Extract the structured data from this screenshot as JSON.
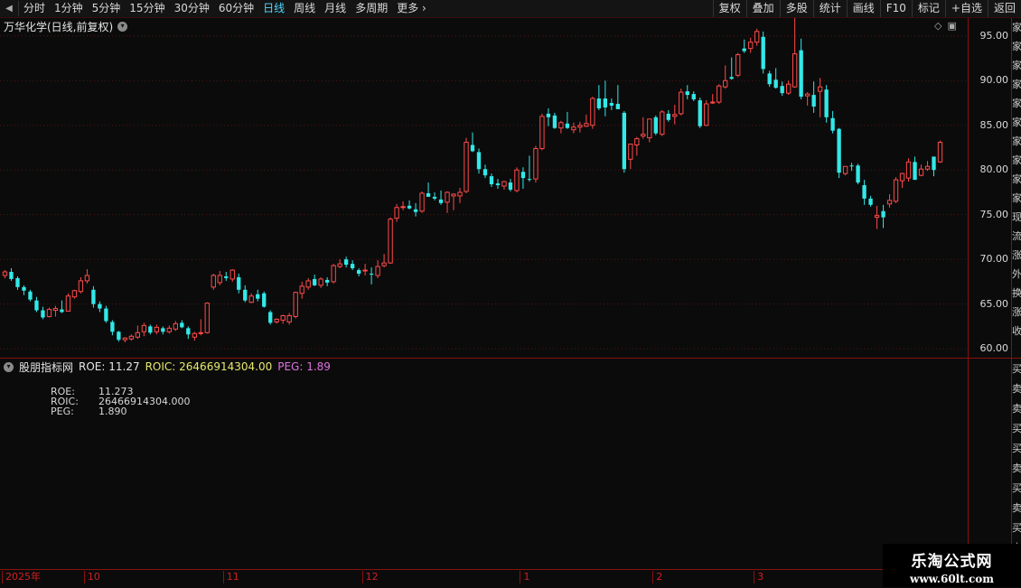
{
  "toolbar": {
    "periods": [
      {
        "label": "分时",
        "active": false
      },
      {
        "label": "1分钟",
        "active": false
      },
      {
        "label": "5分钟",
        "active": false
      },
      {
        "label": "15分钟",
        "active": false
      },
      {
        "label": "30分钟",
        "active": false
      },
      {
        "label": "60分钟",
        "active": false
      },
      {
        "label": "日线",
        "active": true
      },
      {
        "label": "周线",
        "active": false
      },
      {
        "label": "月线",
        "active": false
      },
      {
        "label": "多周期",
        "active": false
      },
      {
        "label": "更多",
        "active": false
      }
    ],
    "right_buttons": [
      "复权",
      "叠加",
      "多股",
      "统计",
      "画线",
      "F10",
      "标记",
      "+自选",
      "返回"
    ]
  },
  "chart": {
    "title": "万华化学(日线,前复权)",
    "price_ticks": [
      "95.00",
      "90.00",
      "85.00",
      "80.00",
      "75.00",
      "70.00",
      "65.00",
      "60.00"
    ],
    "right_strip_text": "家家家家家家家家家家现流涨外换涨收",
    "lower_strip_text": "买卖卖买买卖买卖买卖"
  },
  "indicator": {
    "name": "股朋指标网",
    "roe_text": "ROE: 11.27",
    "roic_text": "ROIC: 26466914304.00",
    "peg_text": "PEG: 1.89",
    "rows": [
      {
        "label": "ROE:",
        "value": "11.273"
      },
      {
        "label": "ROIC:",
        "value": "26466914304.000"
      },
      {
        "label": "PEG:",
        "value": "1.890"
      }
    ],
    "colors": {
      "roe": "#e6e6e6",
      "roic": "#e8e870",
      "peg": "#e070e0"
    }
  },
  "date_axis": {
    "labels": [
      {
        "text": "2025年",
        "index": 0
      },
      {
        "text": "10",
        "index": 13
      },
      {
        "text": "11",
        "index": 35
      },
      {
        "text": "12",
        "index": 57
      },
      {
        "text": "1",
        "index": 82
      },
      {
        "text": "2",
        "index": 103
      },
      {
        "text": "3",
        "index": 119
      }
    ]
  },
  "watermark": {
    "title": "乐淘公式网",
    "url": "www.60lt.com"
  },
  "colors": {
    "up": "#ff4a4a",
    "down": "#33e8e8",
    "grid": "#5a1414",
    "axis": "#8a1010",
    "active_tab": "#4fd8ff"
  },
  "chart_data": {
    "type": "candlestick",
    "title": "万华化学(日线,前复权)",
    "ylim": [
      59,
      97
    ],
    "candles": [
      [
        68.2,
        68.8,
        67.9,
        68.6
      ],
      [
        68.6,
        69.0,
        67.6,
        67.8
      ],
      [
        67.9,
        68.1,
        66.6,
        66.9
      ],
      [
        66.9,
        67.1,
        66.0,
        66.5
      ],
      [
        66.4,
        66.6,
        65.3,
        65.5
      ],
      [
        65.4,
        65.8,
        64.1,
        64.3
      ],
      [
        64.3,
        64.7,
        63.3,
        63.5
      ],
      [
        63.6,
        64.6,
        63.5,
        64.4
      ],
      [
        64.3,
        64.8,
        63.6,
        64.5
      ],
      [
        64.4,
        65.4,
        64.0,
        64.1
      ],
      [
        64.2,
        66.2,
        64.2,
        65.9
      ],
      [
        65.8,
        66.6,
        65.6,
        66.5
      ],
      [
        66.4,
        68.0,
        66.2,
        67.6
      ],
      [
        67.6,
        68.9,
        67.3,
        68.2
      ],
      [
        66.6,
        67.0,
        64.6,
        65.0
      ],
      [
        65.0,
        65.3,
        64.1,
        64.5
      ],
      [
        64.5,
        64.8,
        62.9,
        63.1
      ],
      [
        63.0,
        63.2,
        61.5,
        61.9
      ],
      [
        61.9,
        62.0,
        60.8,
        61.0
      ],
      [
        61.0,
        61.3,
        60.7,
        61.2
      ],
      [
        61.1,
        61.6,
        60.9,
        61.4
      ],
      [
        61.3,
        62.6,
        61.1,
        61.8
      ],
      [
        61.9,
        62.9,
        61.4,
        62.6
      ],
      [
        62.5,
        62.7,
        61.6,
        61.8
      ],
      [
        61.9,
        62.7,
        61.6,
        62.4
      ],
      [
        62.3,
        62.5,
        61.6,
        61.9
      ],
      [
        61.9,
        62.6,
        61.7,
        62.3
      ],
      [
        62.2,
        63.1,
        62.0,
        62.8
      ],
      [
        62.9,
        63.2,
        62.3,
        62.4
      ],
      [
        62.3,
        62.5,
        61.1,
        61.6
      ],
      [
        61.3,
        61.9,
        60.9,
        61.7
      ],
      [
        61.8,
        63.3,
        61.5,
        61.8
      ],
      [
        61.8,
        65.2,
        61.7,
        65.1
      ],
      [
        66.9,
        68.4,
        66.6,
        68.2
      ],
      [
        67.4,
        68.7,
        67.1,
        68.2
      ],
      [
        68.1,
        68.6,
        67.6,
        67.9
      ],
      [
        67.8,
        68.9,
        67.5,
        68.8
      ],
      [
        68.0,
        68.4,
        66.2,
        66.6
      ],
      [
        66.6,
        67.1,
        65.2,
        65.4
      ],
      [
        65.2,
        66.2,
        65.1,
        65.9
      ],
      [
        66.1,
        66.6,
        65.3,
        65.6
      ],
      [
        66.2,
        66.4,
        64.6,
        64.7
      ],
      [
        64.1,
        64.3,
        62.7,
        62.9
      ],
      [
        63.0,
        63.4,
        62.8,
        63.3
      ],
      [
        63.2,
        63.8,
        62.8,
        63.7
      ],
      [
        63.0,
        64.0,
        62.7,
        63.7
      ],
      [
        63.6,
        66.4,
        63.4,
        66.3
      ],
      [
        66.2,
        67.5,
        65.6,
        67.0
      ],
      [
        66.9,
        67.9,
        66.6,
        67.6
      ],
      [
        67.8,
        68.3,
        67.0,
        67.1
      ],
      [
        67.1,
        68.0,
        66.8,
        67.8
      ],
      [
        67.7,
        68.0,
        67.0,
        67.4
      ],
      [
        67.5,
        69.5,
        67.3,
        69.3
      ],
      [
        69.2,
        70.0,
        69.0,
        69.5
      ],
      [
        70.0,
        70.3,
        69.1,
        69.4
      ],
      [
        69.5,
        69.9,
        68.8,
        69.0
      ],
      [
        68.8,
        69.0,
        68.1,
        68.4
      ],
      [
        68.8,
        69.5,
        68.2,
        68.8
      ],
      [
        68.4,
        69.1,
        67.2,
        68.3
      ],
      [
        68.2,
        69.9,
        67.9,
        69.2
      ],
      [
        69.3,
        70.6,
        69.1,
        69.6
      ],
      [
        69.6,
        74.7,
        69.5,
        74.5
      ],
      [
        74.6,
        76.2,
        74.2,
        75.8
      ],
      [
        75.8,
        76.5,
        75.5,
        75.9
      ],
      [
        76.0,
        76.6,
        75.6,
        75.7
      ],
      [
        75.6,
        76.3,
        74.8,
        75.3
      ],
      [
        75.4,
        77.6,
        75.2,
        77.4
      ],
      [
        77.4,
        78.6,
        77.0,
        77.0
      ],
      [
        77.0,
        77.5,
        76.6,
        76.8
      ],
      [
        76.7,
        77.7,
        76.1,
        76.3
      ],
      [
        76.4,
        77.6,
        75.2,
        77.5
      ],
      [
        77.1,
        77.4,
        75.5,
        77.3
      ],
      [
        77.1,
        78.0,
        76.3,
        77.5
      ],
      [
        77.6,
        83.6,
        77.4,
        83.1
      ],
      [
        82.8,
        84.2,
        82.0,
        82.1
      ],
      [
        82.0,
        82.4,
        79.6,
        80.1
      ],
      [
        80.1,
        80.6,
        79.1,
        79.4
      ],
      [
        79.3,
        79.6,
        78.1,
        78.4
      ],
      [
        78.5,
        79.0,
        77.9,
        78.3
      ],
      [
        78.2,
        78.8,
        77.8,
        78.7
      ],
      [
        78.6,
        79.0,
        77.6,
        77.8
      ],
      [
        77.7,
        80.3,
        77.5,
        80.0
      ],
      [
        79.8,
        80.3,
        77.9,
        79.1
      ],
      [
        79.0,
        81.6,
        78.7,
        78.9
      ],
      [
        79.0,
        82.7,
        78.6,
        82.4
      ],
      [
        82.4,
        86.3,
        82.2,
        86.0
      ],
      [
        86.3,
        86.9,
        84.9,
        85.9
      ],
      [
        86.1,
        86.4,
        84.6,
        84.7
      ],
      [
        84.7,
        85.5,
        84.1,
        85.3
      ],
      [
        85.2,
        86.5,
        84.6,
        84.7
      ],
      [
        84.5,
        85.3,
        84.1,
        84.8
      ],
      [
        84.8,
        85.4,
        84.2,
        85.0
      ],
      [
        84.9,
        86.2,
        84.8,
        85.2
      ],
      [
        85.0,
        88.2,
        84.6,
        88.0
      ],
      [
        88.0,
        89.5,
        86.7,
        86.9
      ],
      [
        88.0,
        90.0,
        86.0,
        87.0
      ],
      [
        87.5,
        88.0,
        86.7,
        87.2
      ],
      [
        87.4,
        89.5,
        86.9,
        86.8
      ],
      [
        86.4,
        86.6,
        79.7,
        80.1
      ],
      [
        81.2,
        82.0,
        80.1,
        82.9
      ],
      [
        82.8,
        83.7,
        81.6,
        83.5
      ],
      [
        83.8,
        85.9,
        83.5,
        84.0
      ],
      [
        83.6,
        84.6,
        83.1,
        85.7
      ],
      [
        85.9,
        86.1,
        83.9,
        84.1
      ],
      [
        84.0,
        86.7,
        83.8,
        86.5
      ],
      [
        86.3,
        86.7,
        85.4,
        85.6
      ],
      [
        86.0,
        87.3,
        85.1,
        86.2
      ],
      [
        86.3,
        89.1,
        86.1,
        88.7
      ],
      [
        88.8,
        89.5,
        87.9,
        88.4
      ],
      [
        88.5,
        88.8,
        87.7,
        87.9
      ],
      [
        87.8,
        88.1,
        84.7,
        84.9
      ],
      [
        85.0,
        87.8,
        84.9,
        87.4
      ],
      [
        87.6,
        88.5,
        87.4,
        87.6
      ],
      [
        87.6,
        89.6,
        87.4,
        89.4
      ],
      [
        89.3,
        91.7,
        89.1,
        90.0
      ],
      [
        90.4,
        92.6,
        90.1,
        90.2
      ],
      [
        90.6,
        93.1,
        90.4,
        92.9
      ],
      [
        93.6,
        94.6,
        93.1,
        93.3
      ],
      [
        93.6,
        94.8,
        93.1,
        94.3
      ],
      [
        94.3,
        95.8,
        93.9,
        95.5
      ],
      [
        94.9,
        95.5,
        90.8,
        91.3
      ],
      [
        90.8,
        91.1,
        89.3,
        89.6
      ],
      [
        90.1,
        91.4,
        89.1,
        89.2
      ],
      [
        89.4,
        89.9,
        88.3,
        88.6
      ],
      [
        88.6,
        90.0,
        88.4,
        89.6
      ],
      [
        89.3,
        97.1,
        89.2,
        93.0
      ],
      [
        93.4,
        94.7,
        87.9,
        88.2
      ],
      [
        88.3,
        88.7,
        87.2,
        88.5
      ],
      [
        88.4,
        89.9,
        86.4,
        87.1
      ],
      [
        88.8,
        90.3,
        85.9,
        89.3
      ],
      [
        89.0,
        89.5,
        85.3,
        85.9
      ],
      [
        85.8,
        86.6,
        84.1,
        84.4
      ],
      [
        84.6,
        84.7,
        79.1,
        79.7
      ],
      [
        79.6,
        80.4,
        79.4,
        80.4
      ],
      [
        80.5,
        80.8,
        79.9,
        80.4
      ],
      [
        80.5,
        80.7,
        78.4,
        78.6
      ],
      [
        78.3,
        78.9,
        76.1,
        76.8
      ],
      [
        76.8,
        77.1,
        75.9,
        76.1
      ],
      [
        74.7,
        76.0,
        73.4,
        74.9
      ],
      [
        75.4,
        76.1,
        73.5,
        74.7
      ],
      [
        76.2,
        77.3,
        75.8,
        76.6
      ],
      [
        76.5,
        79.2,
        76.3,
        78.9
      ],
      [
        78.8,
        79.7,
        78.0,
        79.6
      ],
      [
        79.1,
        81.3,
        78.7,
        80.9
      ],
      [
        80.9,
        81.5,
        78.9,
        78.9
      ],
      [
        79.4,
        80.6,
        79.3,
        80.1
      ],
      [
        80.1,
        81.0,
        79.9,
        80.4
      ],
      [
        81.5,
        81.4,
        79.3,
        80.0
      ],
      [
        80.9,
        83.3,
        80.8,
        83.1
      ]
    ]
  }
}
